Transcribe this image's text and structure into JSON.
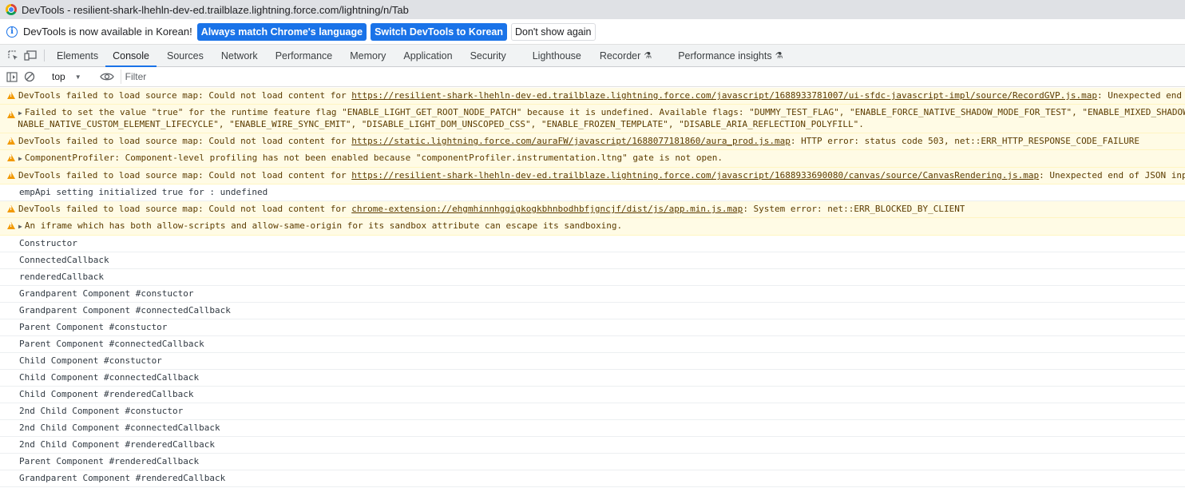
{
  "window": {
    "title": "DevTools - resilient-shark-lhehln-dev-ed.trailblaze.lightning.force.com/lightning/n/Tab"
  },
  "infobar": {
    "message": "DevTools is now available in Korean!",
    "btn_match": "Always match Chrome's language",
    "btn_switch": "Switch DevTools to Korean",
    "btn_dismiss": "Don't show again"
  },
  "tabs": [
    {
      "label": "Elements"
    },
    {
      "label": "Console"
    },
    {
      "label": "Sources"
    },
    {
      "label": "Network"
    },
    {
      "label": "Performance"
    },
    {
      "label": "Memory"
    },
    {
      "label": "Application"
    },
    {
      "label": "Security"
    },
    {
      "label": "Lighthouse"
    },
    {
      "label": "Recorder"
    },
    {
      "label": "Performance insights"
    }
  ],
  "toolbar": {
    "context": "top",
    "filter_placeholder": "Filter"
  },
  "console": {
    "m1": {
      "pre": "DevTools failed to load source map: Could not load content for ",
      "link": "https://resilient-shark-lhehln-dev-ed.trailblaze.lightning.force.com/javascript/1688933781007/ui-sfdc-javascript-impl/source/RecordGVP.js.map",
      "post": ": Unexpected end of JSON input"
    },
    "m2": {
      "line1": "Failed to set the value \"true\" for the runtime feature flag \"ENABLE_LIGHT_GET_ROOT_NODE_PATCH\" because it is undefined. Available flags: \"DUMMY_TEST_FLAG\", \"ENABLE_FORCE_NATIVE_SHADOW_MODE_FOR_TEST\", \"ENABLE_MIXED_SHADOW_MODE\",",
      "line2": "\"ENABLE_NATIVE_CUSTOM_ELEMENT_LIFECYCLE\", \"ENABLE_WIRE_SYNC_EMIT\", \"DISABLE_LIGHT_DOM_UNSCOPED_CSS\", \"ENABLE_FROZEN_TEMPLATE\", \"DISABLE_ARIA_REFLECTION_POLYFILL\"."
    },
    "m3": {
      "pre": "DevTools failed to load source map: Could not load content for ",
      "link": "https://static.lightning.force.com/auraFW/javascript/1688077181860/aura_prod.js.map",
      "post": ": HTTP error: status code 503, net::ERR_HTTP_RESPONSE_CODE_FAILURE"
    },
    "m4": {
      "text": "ComponentProfiler: Component-level profiling has not been enabled because \"componentProfiler.instrumentation.ltng\" gate is not open."
    },
    "m5": {
      "pre": "DevTools failed to load source map: Could not load content for ",
      "link": "https://resilient-shark-lhehln-dev-ed.trailblaze.lightning.force.com/javascript/1688933690080/canvas/source/CanvasRendering.js.map",
      "post": ": Unexpected end of JSON input"
    },
    "m6": {
      "text": "empApi setting initialized true for : undefined"
    },
    "m7": {
      "pre": "DevTools failed to load source map: Could not load content for ",
      "link": "chrome-extension://ehgmhinnhggigkogkbhnbodhbfjgncjf/dist/js/app.min.js.map",
      "post": ": System error: net::ERR_BLOCKED_BY_CLIENT"
    },
    "m8": {
      "text": "An iframe which has both allow-scripts and allow-same-origin for its sandbox attribute can escape its sandboxing."
    },
    "logs": [
      "Constructor",
      "ConnectedCallback",
      "renderedCallback",
      "Grandparent Component #constuctor",
      "Grandparent Component #connectedCallback",
      "Parent Component #constuctor",
      "Parent Component #connectedCallback",
      "Child Component #constuctor",
      "Child Component #connectedCallback",
      "Child Component #renderedCallback",
      "2nd Child Component #constuctor",
      "2nd Child Component #connectedCallback",
      "2nd Child Component #renderedCallback",
      "Parent Component #renderedCallback",
      "Grandparent Component #renderedCallback"
    ]
  }
}
